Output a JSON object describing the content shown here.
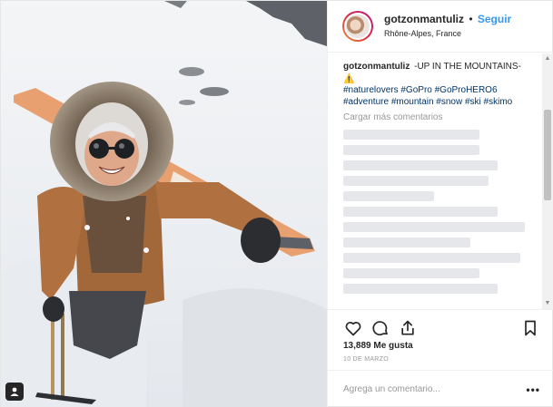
{
  "header": {
    "username": "gotzonmantuliz",
    "separator": "•",
    "follow_label": "Seguir",
    "location": "Rhône-Alpes, France"
  },
  "caption": {
    "username": "gotzonmantuliz",
    "text": "-UP IN THE MOUNTAINS-",
    "warning_glyph": "⚠️",
    "hashtags": "#naturelovers #GoPro #GoProHERO6 #adventure #mountain #snow #ski #skimo"
  },
  "load_more_label": "Cargar más comentarios",
  "icons": {
    "like": "heart-icon",
    "comment": "comment-icon",
    "share": "share-icon",
    "save": "bookmark-icon",
    "user_tag": "user-tag-icon",
    "options": "more-options-icon"
  },
  "likes_text": "13,889 Me gusta",
  "date_text": "10 DE MARZO",
  "comment_placeholder": "Agrega un comentario...",
  "options_glyph": "•••",
  "scroll_up_glyph": "▲",
  "scroll_down_glyph": "▼",
  "colors": {
    "follow": "#3897f0",
    "hashtag": "#003569",
    "muted": "#999999"
  }
}
